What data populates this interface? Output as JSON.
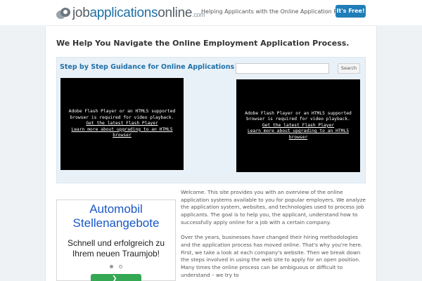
{
  "header": {
    "logo": {
      "part1": "job",
      "part2": "applications",
      "part3": "online",
      "tld": ".com"
    },
    "tagline": "Helping Applicants with the Online Application Process",
    "free_button": "It's Free!"
  },
  "main": {
    "title": "We Help You Navigate the Online Employment Application Process.",
    "guide_title": "Step by Step Guidance for Online Applications",
    "search": {
      "value": "",
      "button_label": "Search"
    },
    "videos": [
      {
        "message": "Adobe Flash Player or an HTML5 supported browser is required for video playback.",
        "link1": "Get the latest Flash Player",
        "link2": "Learn more about upgrading to an HTML5 browser"
      },
      {
        "message": "Adobe Flash Player or an HTML5 supported browser is required for video playback.",
        "link1": "Get the latest Flash Player",
        "link2": "Learn more about upgrading to an HTML5 browser"
      }
    ],
    "ad": {
      "title": "Automobil Stellenangebote",
      "subtitle": "Schnell und erfolgreich zu Ihrem neuen Traumjob!",
      "button_icon": "arrow-right-icon"
    },
    "paragraphs": [
      "Welcome. This site provides you with an overview of the online application systems available to you for popular employers. We analyze the application system, websites, and technologies used to process job applicants. The goal is to help you, the applicant, understand how to successfully apply online for a job with a certain company.",
      "Over the years, businesses have changed their hiring methodologies and the application process has moved online. That's why you're here. First, we take a look at each company's website. Then we break down the steps involved in using the web site to apply for an open position. Many times the online process can be ambiguous or difficult to understand – we try to"
    ]
  },
  "colors": {
    "brand_blue": "#1e6fa7",
    "button_blue": "#1f7db8",
    "panel_blue": "#e9f1f8",
    "ad_blue": "#1a57c7",
    "ad_green": "#34a853"
  }
}
